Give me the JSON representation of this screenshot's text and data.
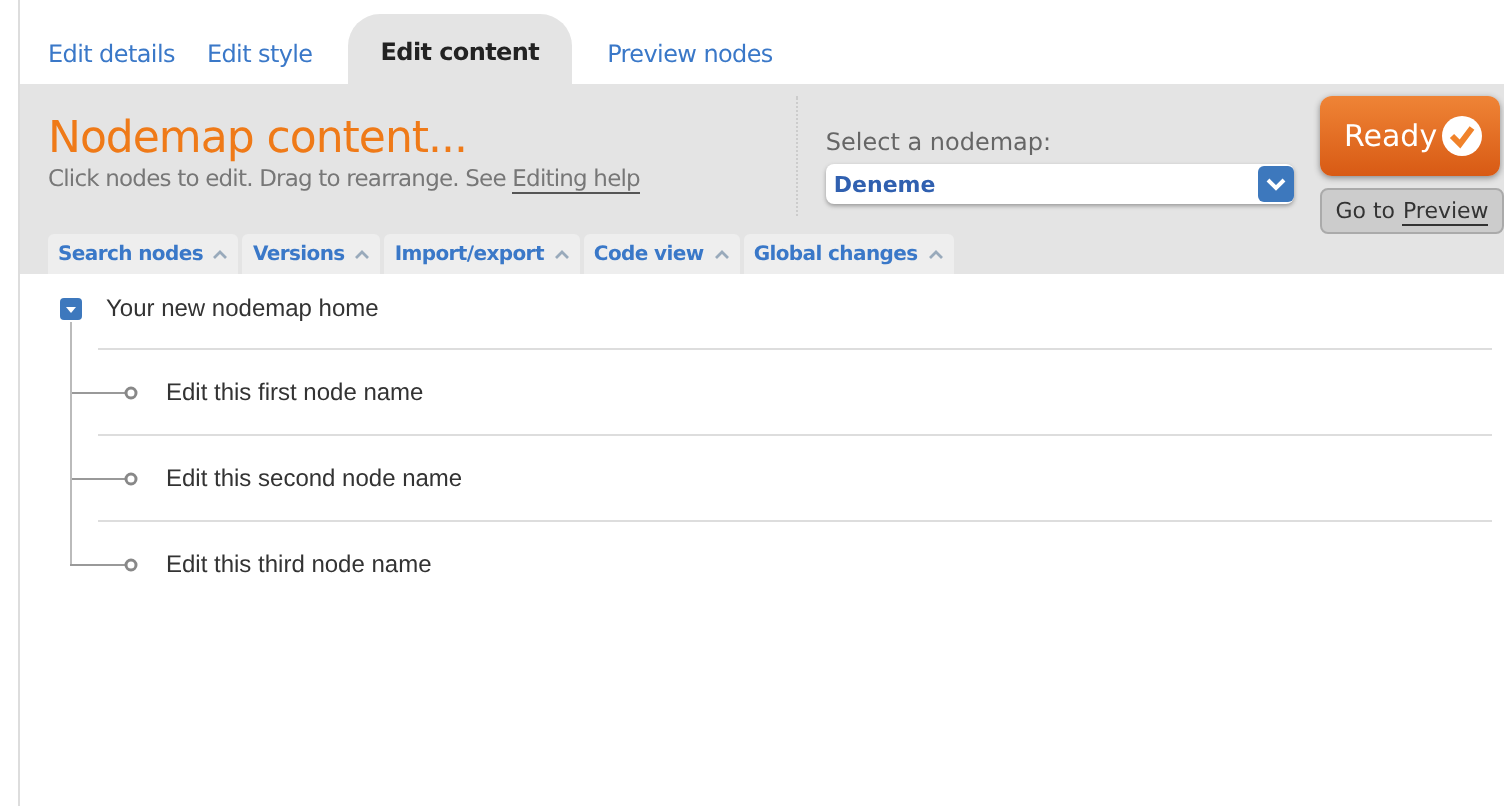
{
  "tabs": [
    {
      "label": "Edit details",
      "selected": false
    },
    {
      "label": "Edit style",
      "selected": false
    },
    {
      "label": "Edit content",
      "selected": true
    },
    {
      "label": "Preview nodes",
      "selected": false
    }
  ],
  "header": {
    "title": "Nodemap content...",
    "hint": "Click nodes to edit. Drag to rearrange. See",
    "help_link": "Editing help"
  },
  "nodemap_select": {
    "label": "Select a nodemap:",
    "value": "Deneme"
  },
  "ready_button": {
    "label": "Ready"
  },
  "goto_button": {
    "prefix": "Go to",
    "link": "Preview"
  },
  "toolbar": [
    {
      "label": "Search nodes"
    },
    {
      "label": "Versions"
    },
    {
      "label": "Import/export"
    },
    {
      "label": "Code view"
    },
    {
      "label": "Global changes"
    }
  ],
  "tree": {
    "label": "Your new nodemap home",
    "expanded": true,
    "children": [
      {
        "label": "Edit this first node name"
      },
      {
        "label": "Edit this second node name"
      },
      {
        "label": "Edit this third node name"
      }
    ]
  }
}
